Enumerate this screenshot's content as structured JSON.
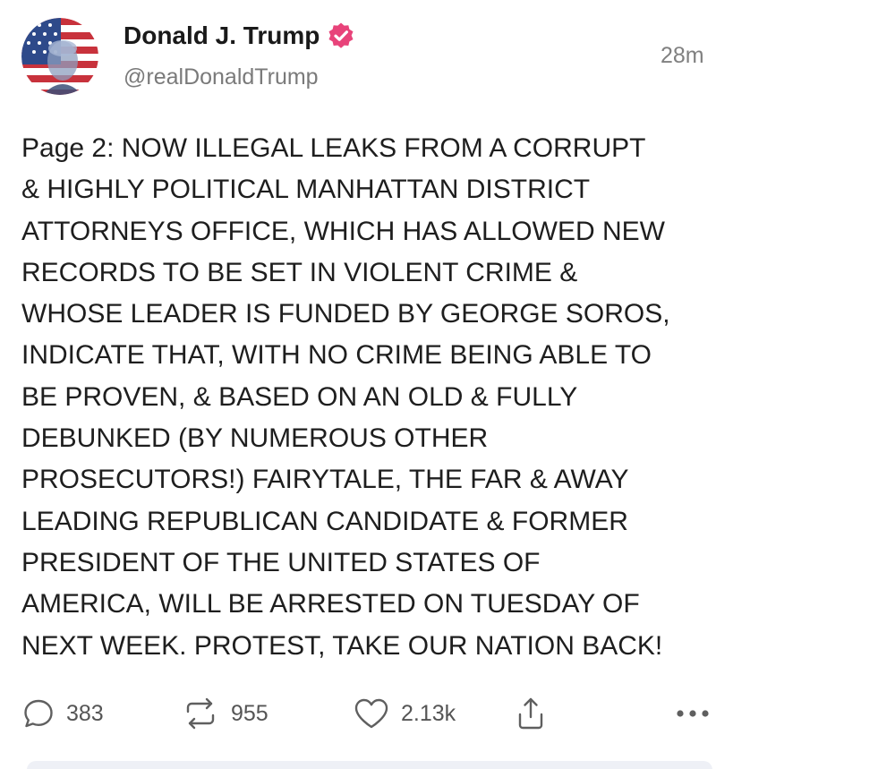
{
  "post": {
    "author": {
      "name": "Donald J. Trump",
      "handle": "@realDonaldTrump",
      "verified": true,
      "avatar_icon": "flag-portrait-avatar",
      "verified_icon": "verified-badge-icon",
      "verified_color": "#e8437a"
    },
    "timestamp": "28m",
    "text_lines": [
      "Page 2: NOW ILLEGAL LEAKS FROM A CORRUPT",
      "& HIGHLY POLITICAL MANHATTAN DISTRICT",
      "ATTORNEYS OFFICE, WHICH HAS ALLOWED NEW",
      "RECORDS TO BE SET IN VIOLENT CRIME &",
      "WHOSE LEADER IS FUNDED BY GEORGE SOROS,",
      "INDICATE THAT, WITH NO CRIME BEING ABLE TO",
      "BE PROVEN, & BASED ON AN OLD & FULLY",
      "DEBUNKED (BY NUMEROUS OTHER",
      "PROSECUTORS!) FAIRYTALE, THE FAR & AWAY",
      "LEADING REPUBLICAN CANDIDATE & FORMER",
      "PRESIDENT OF THE UNITED STATES OF",
      "AMERICA, WILL BE ARRESTED ON TUESDAY OF",
      "NEXT WEEK. PROTEST, TAKE OUR NATION BACK!"
    ],
    "actions": {
      "replies": {
        "icon": "reply-bubble-icon",
        "count": "383"
      },
      "reposts": {
        "icon": "repost-arrows-icon",
        "count": "955"
      },
      "likes": {
        "icon": "heart-icon",
        "count": "2.13k"
      },
      "share": {
        "icon": "share-upload-icon"
      },
      "more": {
        "icon": "more-dots-icon"
      }
    }
  }
}
